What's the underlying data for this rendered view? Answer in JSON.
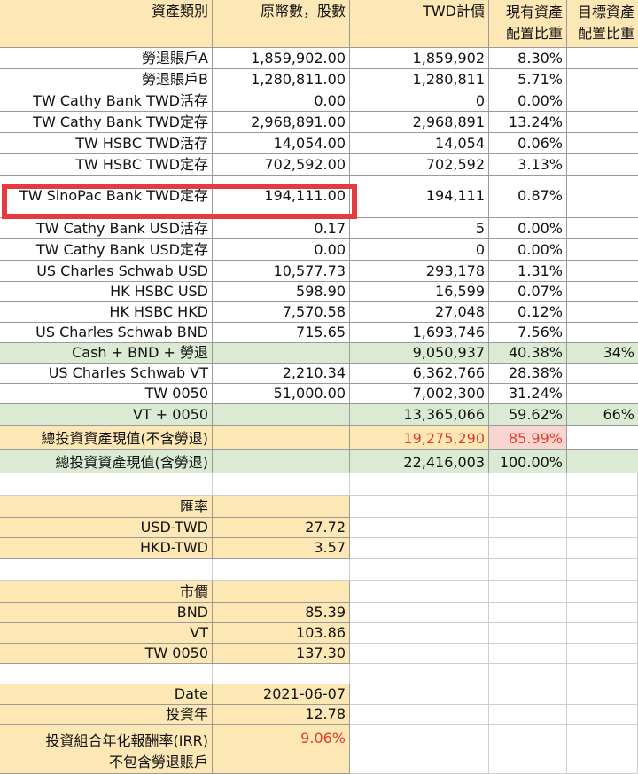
{
  "header": {
    "col0": "資產類別",
    "col1": "原幣數，股數",
    "col2": "TWD計價",
    "col3_line1": "現有資產",
    "col3_line2": "配置比重",
    "col4_line1": "目標資產",
    "col4_line2": "配置比重"
  },
  "assets": [
    {
      "name": "勞退賬戶A",
      "orig": "1,859,902.00",
      "twd": "1,859,902",
      "pct": "8.30%",
      "target": ""
    },
    {
      "name": "勞退賬戶B",
      "orig": "1,280,811.00",
      "twd": "1,280,811",
      "pct": "5.71%",
      "target": ""
    },
    {
      "name": "TW Cathy Bank TWD活存",
      "orig": "0.00",
      "twd": "0",
      "pct": "0.00%",
      "target": ""
    },
    {
      "name": "TW Cathy Bank TWD定存",
      "orig": "2,968,891.00",
      "twd": "2,968,891",
      "pct": "13.24%",
      "target": ""
    },
    {
      "name": "TW HSBC TWD活存",
      "orig": "14,054.00",
      "twd": "14,054",
      "pct": "0.06%",
      "target": ""
    },
    {
      "name": "TW HSBC TWD定存",
      "orig": "702,592.00",
      "twd": "702,592",
      "pct": "3.13%",
      "target": ""
    },
    {
      "name": "TW SinoPac Bank TWD定存",
      "orig": "194,111.00",
      "twd": "194,111",
      "pct": "0.87%",
      "target": ""
    },
    {
      "name": "TW Cathy Bank USD活存",
      "orig": "0.17",
      "twd": "5",
      "pct": "0.00%",
      "target": ""
    },
    {
      "name": "TW Cathy Bank USD定存",
      "orig": "0.00",
      "twd": "0",
      "pct": "0.00%",
      "target": ""
    },
    {
      "name": "US Charles Schwab USD",
      "orig": "10,577.73",
      "twd": "293,178",
      "pct": "1.31%",
      "target": ""
    },
    {
      "name": "HK HSBC USD",
      "orig": "598.90",
      "twd": "16,599",
      "pct": "0.07%",
      "target": ""
    },
    {
      "name": "HK HSBC HKD",
      "orig": "7,570.58",
      "twd": "27,048",
      "pct": "0.12%",
      "target": ""
    },
    {
      "name": "US Charles Schwab BND",
      "orig": "715.65",
      "twd": "1,693,746",
      "pct": "7.56%",
      "target": ""
    }
  ],
  "cash_subtotal": {
    "name": "Cash + BND + 勞退",
    "twd": "9,050,937",
    "pct": "40.38%",
    "target": "34%"
  },
  "equities": [
    {
      "name": "US Charles Schwab VT",
      "orig": "2,210.34",
      "twd": "6,362,766",
      "pct": "28.38%"
    },
    {
      "name": "TW 0050",
      "orig": "51,000.00",
      "twd": "7,002,300",
      "pct": "31.24%"
    }
  ],
  "equity_subtotal": {
    "name": "VT + 0050",
    "twd": "13,365,066",
    "pct": "59.62%",
    "target": "66%"
  },
  "total_excl": {
    "name": "總投資資產現值(不含勞退)",
    "twd": "19,275,290",
    "pct": "85.99%"
  },
  "total_incl": {
    "name": "總投資資產現值(含勞退)",
    "twd": "22,416,003",
    "pct": "100.00%"
  },
  "fx": {
    "title": "匯率",
    "rows": [
      {
        "label": "USD-TWD",
        "value": "27.72"
      },
      {
        "label": "HKD-TWD",
        "value": "3.57"
      }
    ]
  },
  "prices": {
    "title": "市價",
    "rows": [
      {
        "label": "BND",
        "value": "85.39"
      },
      {
        "label": "VT",
        "value": "103.86"
      },
      {
        "label": "TW 0050",
        "value": "137.30"
      }
    ]
  },
  "summary": {
    "date_label": "Date",
    "date_value": "2021-06-07",
    "years_label": "投資年",
    "years_value": "12.78",
    "irr_label": "投資組合年化報酬率(IRR)",
    "irr_value": "9.06%",
    "irr_note": "不包含勞退賬戶"
  },
  "colors": {
    "tan": "#fce7b5",
    "green": "#dbead3",
    "pink": "#f8d6cf",
    "red_text": "#e53b2c",
    "highlight": "#e53b40"
  }
}
